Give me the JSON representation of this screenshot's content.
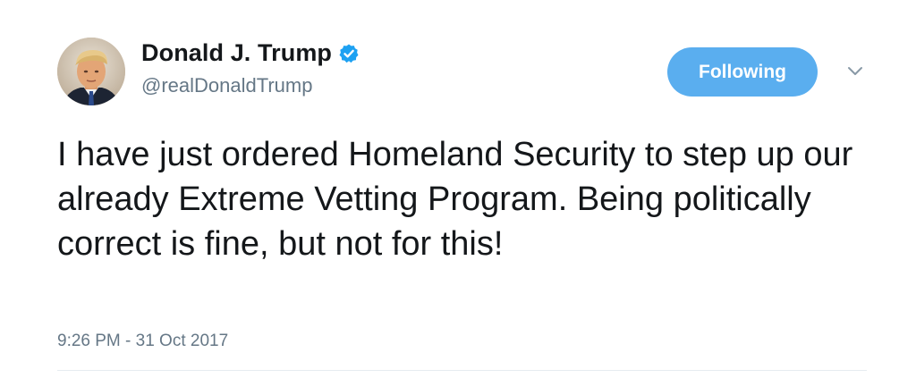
{
  "tweet": {
    "author": {
      "display_name": "Donald J. Trump",
      "screen_name": "@realDonaldTrump",
      "verified": true,
      "avatar_icon": "profile-photo"
    },
    "follow_button": {
      "label": "Following"
    },
    "menu_icon": "chevron-down-icon",
    "text": "I have just ordered Homeland Security to step up our already Extreme Vetting Program. Being politically correct is fine, but not for this!",
    "timestamp": "9:26 PM - 31 Oct 2017"
  },
  "colors": {
    "accent": "#5aaeef",
    "verified": "#1da1f2",
    "secondary_text": "#657786",
    "primary_text": "#14171a",
    "divider": "#e6ecf0"
  }
}
